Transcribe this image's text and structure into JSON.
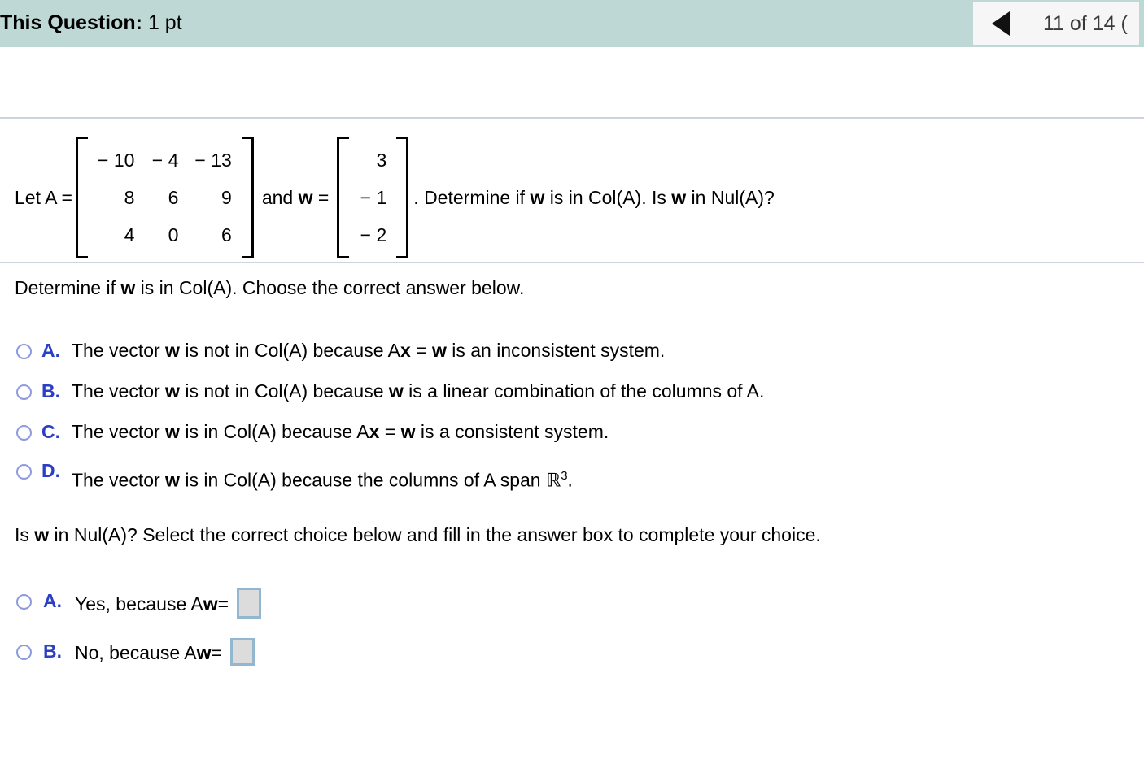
{
  "header": {
    "title_bold": "This Question:",
    "title_value": " 1 pt",
    "prev_icon": "left-triangle-icon",
    "page_counter": "11 of 14 ("
  },
  "problem": {
    "lead": "Let A =",
    "matrix_A": [
      [
        "− 10",
        "− 4",
        "− 13"
      ],
      [
        "8",
        "6",
        "9"
      ],
      [
        "4",
        "0",
        "6"
      ]
    ],
    "conjunction": "and",
    "vector_name": "w",
    "equals": "=",
    "vector_w": [
      "3",
      "− 1",
      "− 2"
    ],
    "tail": ". Determine if ",
    "tail2": " is in Col(A). Is ",
    "tail3": " in Nul(A)?"
  },
  "question_col": {
    "prompt_part1": "Determine if ",
    "prompt_var": "w",
    "prompt_part2": " is in Col(A). Choose the correct answer below.",
    "choices": [
      {
        "letter": "A.",
        "segments": [
          "The vector ",
          "w",
          " is not in Col(A) because A",
          "x",
          " = ",
          "w",
          " is an inconsistent system."
        ]
      },
      {
        "letter": "B.",
        "segments": [
          "The vector ",
          "w",
          " is not in Col(A) because ",
          "w",
          " is a linear combination of the columns of A."
        ]
      },
      {
        "letter": "C.",
        "segments": [
          "The vector ",
          "w",
          " is in Col(A) because A",
          "x",
          " = ",
          "w",
          " is a consistent system."
        ]
      },
      {
        "letter": "D.",
        "segments": [
          "The vector ",
          "w",
          " is in Col(A) because the columns of A span ",
          "ℝ",
          "3",
          "."
        ]
      }
    ]
  },
  "question_nul": {
    "prompt_part1": "Is ",
    "prompt_var": "w",
    "prompt_part2": " in Nul(A)? Select the correct choice below and fill in the answer box to complete your choice.",
    "choices": [
      {
        "letter": "A.",
        "text_before": "Yes, because A",
        "var": "w",
        "equals": " =",
        "answer_value": ""
      },
      {
        "letter": "B.",
        "text_before": "No, because A",
        "var": "w",
        "equals": " =",
        "answer_value": ""
      }
    ]
  },
  "colors": {
    "header_bg": "#bdd8d5",
    "divider": "#ced3e0",
    "radio_ring": "#8d9bdd",
    "choice_letter": "#2a3fc4",
    "answer_box_fill": "#dcdcdc",
    "answer_box_border": "#93b7ce",
    "nav_panel": "#f6f6f6"
  }
}
